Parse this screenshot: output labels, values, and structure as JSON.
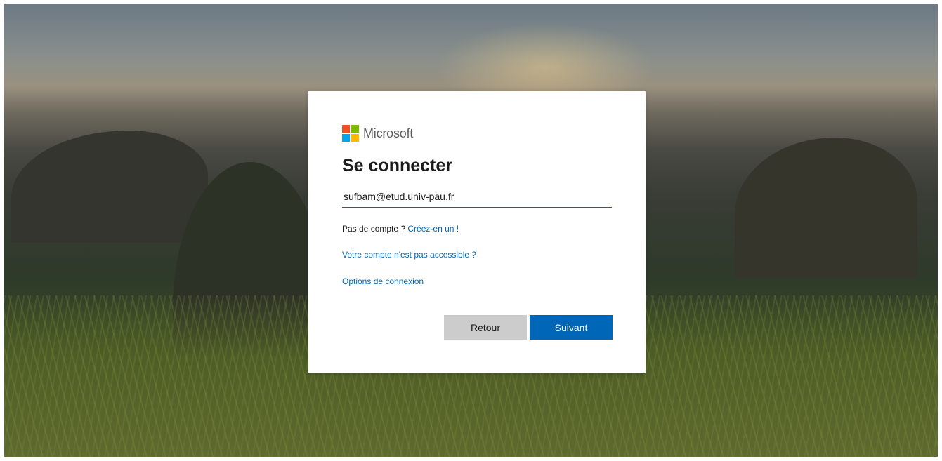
{
  "brand": {
    "name": "Microsoft",
    "logo_colors": [
      "#f25022",
      "#7fba00",
      "#00a4ef",
      "#ffb900"
    ]
  },
  "signin": {
    "title": "Se connecter",
    "email_value": "sufbam@etud.univ-pau.fr",
    "no_account_text": "Pas de compte ? ",
    "create_account_link": "Créez-en un !",
    "cant_access_link": "Votre compte n'est pas accessible ?",
    "signin_options_link": "Options de connexion",
    "back_button": "Retour",
    "next_button": "Suivant"
  },
  "colors": {
    "accent": "#0067b8",
    "secondary_button": "#cccccc"
  }
}
